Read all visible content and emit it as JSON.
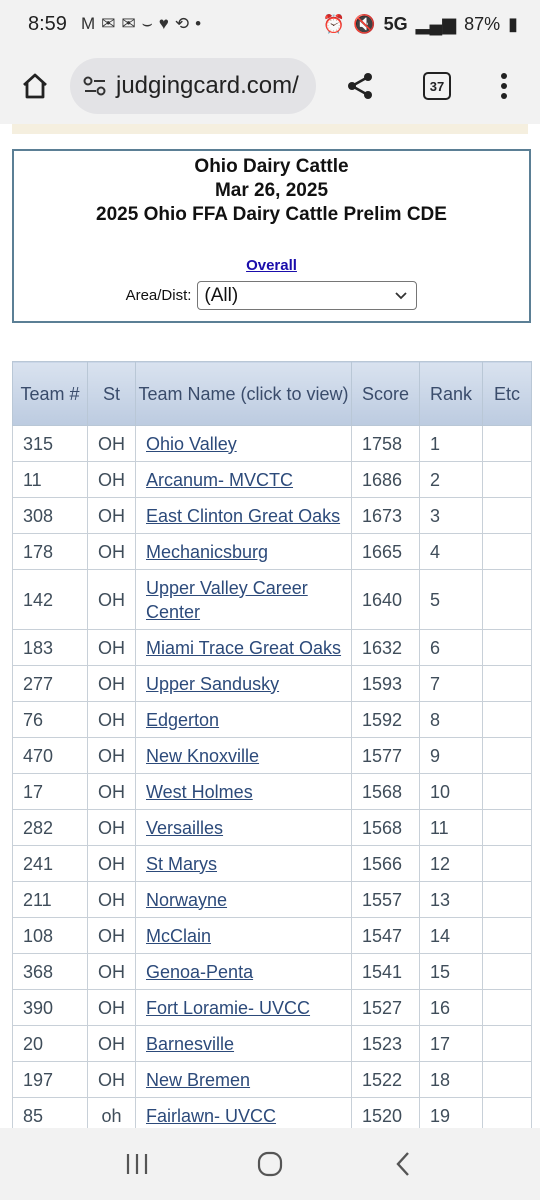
{
  "status": {
    "time": "8:59",
    "network": "5G",
    "battery": "87%"
  },
  "browser": {
    "url": "judgingcard.com/",
    "tab_count": "37"
  },
  "header": {
    "title": "Ohio Dairy Cattle",
    "date": "Mar 26, 2025",
    "event": "2025 Ohio FFA Dairy Cattle Prelim CDE",
    "overall_link": "Overall",
    "area_label": "Area/Dist:",
    "area_selected": "(All)"
  },
  "table": {
    "headers": {
      "team": "Team #",
      "st": "St",
      "name": "Team Name (click to view)",
      "score": "Score",
      "rank": "Rank",
      "etc": "Etc"
    },
    "rows": [
      {
        "team": "315",
        "st": "OH",
        "name": "Ohio Valley",
        "score": "1758",
        "rank": "1"
      },
      {
        "team": "11",
        "st": "OH",
        "name": "Arcanum- MVCTC",
        "score": "1686",
        "rank": "2"
      },
      {
        "team": "308",
        "st": "OH",
        "name": "East Clinton Great Oaks",
        "score": "1673",
        "rank": "3"
      },
      {
        "team": "178",
        "st": "OH",
        "name": "Mechanicsburg",
        "score": "1665",
        "rank": "4"
      },
      {
        "team": "142",
        "st": "OH",
        "name": "Upper Valley Career Center",
        "score": "1640",
        "rank": "5"
      },
      {
        "team": "183",
        "st": "OH",
        "name": "Miami Trace Great Oaks",
        "score": "1632",
        "rank": "6"
      },
      {
        "team": "277",
        "st": "OH",
        "name": "Upper Sandusky",
        "score": "1593",
        "rank": "7"
      },
      {
        "team": "76",
        "st": "OH",
        "name": "Edgerton",
        "score": "1592",
        "rank": "8"
      },
      {
        "team": "470",
        "st": "OH",
        "name": "New Knoxville",
        "score": "1577",
        "rank": "9"
      },
      {
        "team": "17",
        "st": "OH",
        "name": "West Holmes",
        "score": "1568",
        "rank": "10"
      },
      {
        "team": "282",
        "st": "OH",
        "name": "Versailles",
        "score": "1568",
        "rank": "11"
      },
      {
        "team": "241",
        "st": "OH",
        "name": "St Marys",
        "score": "1566",
        "rank": "12"
      },
      {
        "team": "211",
        "st": "OH",
        "name": "Norwayne",
        "score": "1557",
        "rank": "13"
      },
      {
        "team": "108",
        "st": "OH",
        "name": "McClain",
        "score": "1547",
        "rank": "14"
      },
      {
        "team": "368",
        "st": "OH",
        "name": "Genoa-Penta",
        "score": "1541",
        "rank": "15"
      },
      {
        "team": "390",
        "st": "OH",
        "name": "Fort Loramie- UVCC",
        "score": "1527",
        "rank": "16"
      },
      {
        "team": "20",
        "st": "OH",
        "name": "Barnesville",
        "score": "1523",
        "rank": "17"
      },
      {
        "team": "197",
        "st": "OH",
        "name": "New Bremen",
        "score": "1522",
        "rank": "18"
      },
      {
        "team": "85",
        "st": "oh",
        "name": "Fairlawn- UVCC",
        "score": "1520",
        "rank": "19"
      }
    ]
  }
}
